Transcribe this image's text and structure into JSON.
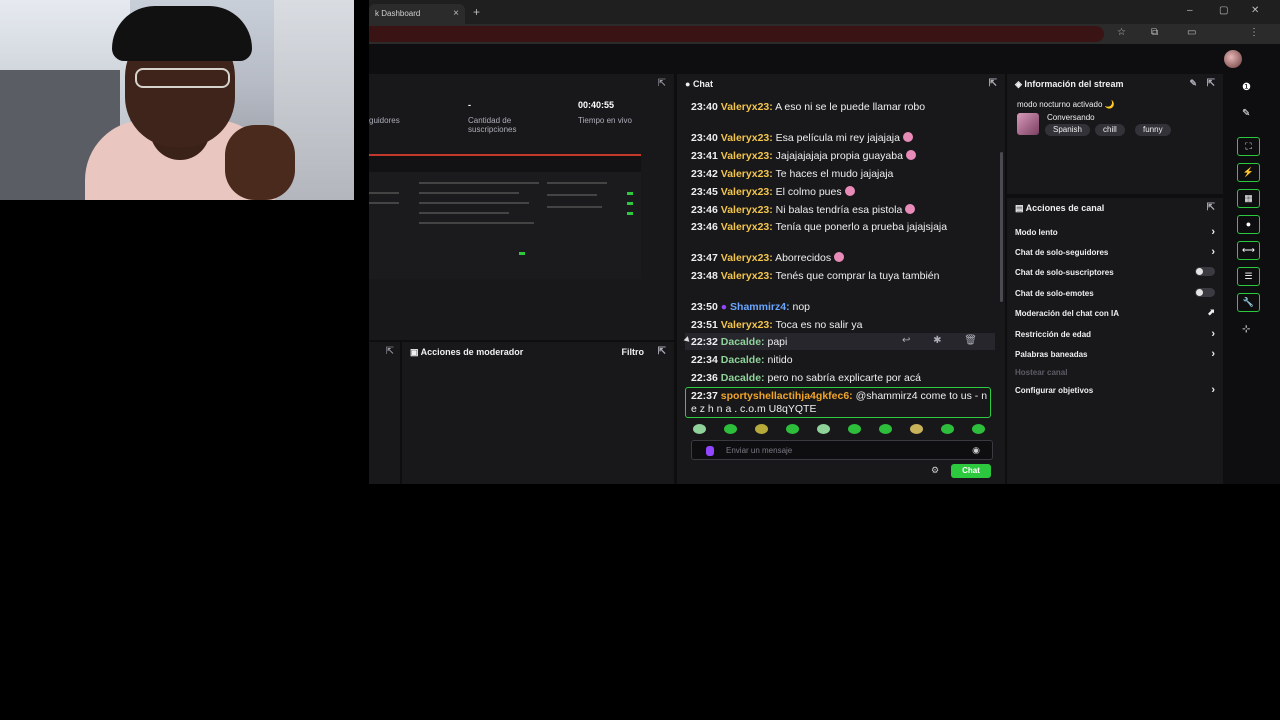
{
  "browser": {
    "tab_title": "k Dashboard",
    "tab_close": "×",
    "new_tab": "+",
    "min": "–",
    "max": "▢",
    "close": "✕"
  },
  "stats": {
    "followers_label": "guidores",
    "subs_value": "-",
    "subs_label": "Cantidad de suscripciones",
    "live_value": "00:40:55",
    "live_label": "Tiempo en vivo"
  },
  "chat": {
    "title": "Chat",
    "messages": [
      {
        "time": "23:40",
        "user": "Valeryx23:",
        "text": " A eso ni se le puede llamar robo"
      },
      {
        "time": "23:40",
        "user": "Valeryx23:",
        "text": " Esa película mi rey jajajaja"
      },
      {
        "time": "23:41",
        "user": "Valeryx23:",
        "text": " Jajajajajaja propia guayaba"
      },
      {
        "time": "23:42",
        "user": "Valeryx23:",
        "text": " Te haces el mudo jajajaja"
      },
      {
        "time": "23:45",
        "user": "Valeryx23:",
        "text": " El colmo pues"
      },
      {
        "time": "23:46",
        "user": "Valeryx23:",
        "text": " Ni balas tendría esa pistola"
      },
      {
        "time": "23:46",
        "user": "Valeryx23:",
        "text": " Tenía que ponerlo a prueba jajajsjaja"
      },
      {
        "time": "23:47",
        "user": "Valeryx23:",
        "text": " Aborrecidos"
      },
      {
        "time": "23:48",
        "user": "Valeryx23:",
        "text": " Tenés que comprar la tuya también"
      },
      {
        "time": "23:50",
        "user": "Shammirz4:",
        "text": " nop"
      },
      {
        "time": "23:51",
        "user": "Valeryx23:",
        "text": " Toca es no salir ya"
      },
      {
        "time": "22:32",
        "user": "Dacalde:",
        "text": " papi"
      },
      {
        "time": "22:34",
        "user": "Dacalde:",
        "text": " nitido"
      },
      {
        "time": "22:36",
        "user": "Dacalde:",
        "text": " pero no sabría explicarte por acá"
      },
      {
        "time": "22:37",
        "user": "sportyshellactihja4gkfec6:",
        "text": " @shammirz4 come to us - n e z h n a . c.o.m U8qYQTE"
      }
    ],
    "input_placeholder": "Enviar un mensaje",
    "send_label": "Chat",
    "hover_actions": "↩ ✱ 🗑"
  },
  "stream_info": {
    "title": "Información del stream",
    "stream_title": "modo nocturno activado 🌙",
    "category": "Conversando",
    "tags": [
      "Spanish",
      "chill",
      "funny"
    ]
  },
  "channel_actions": {
    "title": "Acciones de canal",
    "items": [
      {
        "label": "Modo lento",
        "control": "chevron"
      },
      {
        "label": "Chat de solo-seguidores",
        "control": "chevron"
      },
      {
        "label": "Chat de solo-suscriptores",
        "control": "toggle"
      },
      {
        "label": "Chat de solo-emotes",
        "control": "toggle"
      },
      {
        "label": "Moderación del chat con IA",
        "control": "chart"
      },
      {
        "label": "Restricción de edad",
        "control": "chevron"
      },
      {
        "label": "Palabras baneadas",
        "control": "chevron"
      },
      {
        "label": "Hostear canal",
        "control": "none"
      },
      {
        "label": "Configurar objetivos",
        "control": "chevron"
      }
    ]
  },
  "moderator": {
    "title": "Acciones de moderador",
    "filter": "Filtro"
  },
  "icons": {
    "popout": "⇱",
    "chevron": "›",
    "gear": "⚙",
    "eye": "◉",
    "edit": "✎"
  }
}
